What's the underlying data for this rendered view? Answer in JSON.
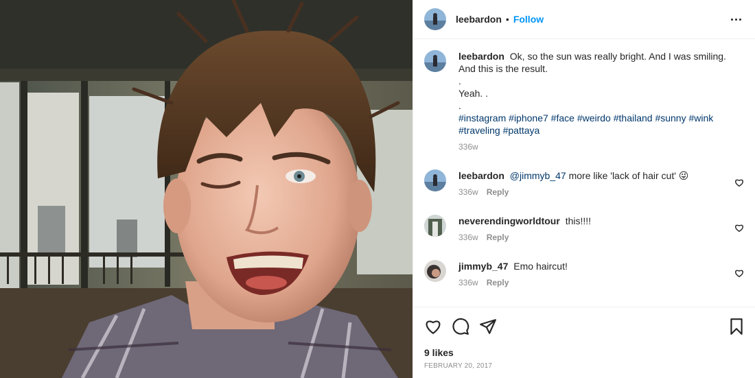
{
  "post": {
    "photo_alt": "Selfie of a man with messy brown hair winking and smiling in bright sunlight"
  },
  "header": {
    "username": "leebardon",
    "separator": "•",
    "follow_label": "Follow",
    "more_icon": "more-options-icon"
  },
  "caption": {
    "username": "leebardon",
    "line1": "Ok, so the sun was really bright. And I was smiling.",
    "line2": "And this is the result.",
    "line3": ".",
    "line4": "Yeah. .",
    "line5": ".",
    "hashtags": [
      "#instagram",
      "#iphone7",
      "#face",
      "#weirdo",
      "#thailand",
      "#sunny",
      "#wink",
      "#traveling",
      "#pattaya"
    ],
    "age": "336w"
  },
  "comments": [
    {
      "username": "leebardon",
      "mention": "@jimmyb_47",
      "text": " more like 'lack of hair cut' ",
      "emoji": "😜",
      "age": "336w",
      "reply_label": "Reply"
    },
    {
      "username": "neverendingworldtour",
      "text": "this!!!!",
      "age": "336w",
      "reply_label": "Reply"
    },
    {
      "username": "jimmyb_47",
      "text": "Emo haircut!",
      "age": "336w",
      "reply_label": "Reply"
    }
  ],
  "actions": {
    "like_icon": "heart-icon",
    "comment_icon": "comment-icon",
    "share_icon": "share-icon",
    "save_icon": "bookmark-icon",
    "likes_text": "9 likes",
    "date": "FEBRUARY 20, 2017"
  }
}
